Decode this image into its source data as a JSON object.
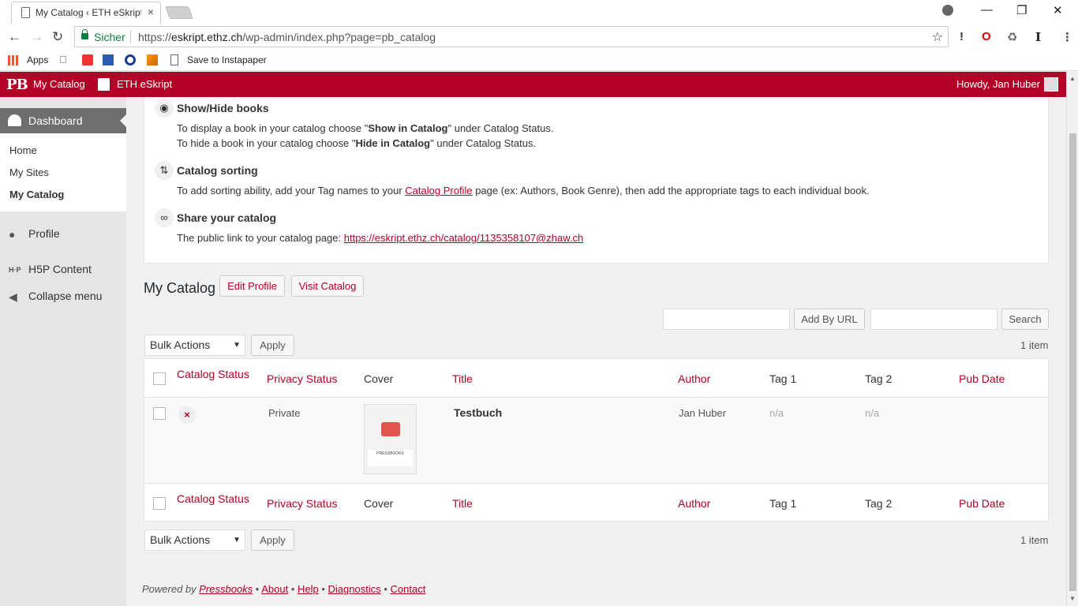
{
  "browser": {
    "tab_title": "My Catalog ‹ ETH eSkript",
    "tab_close": "×",
    "url_secure_label": "Sicher",
    "url_prefix": "https://",
    "url_host": "eskript.ethz.ch",
    "url_path": "/wp-admin/index.php?page=pb_catalog",
    "bookmarks": {
      "apps": "Apps",
      "instapaper": "Save to Instapaper"
    }
  },
  "adminbar": {
    "logo": "PB",
    "my_catalog": "My Catalog",
    "site_name": "ETH eSkript",
    "howdy": "Howdy, Jan Huber"
  },
  "sidebar": {
    "dashboard": "Dashboard",
    "submenu": [
      "Home",
      "My Sites",
      "My Catalog"
    ],
    "profile": "Profile",
    "h5p": "H5P Content",
    "collapse": "Collapse menu"
  },
  "info": {
    "show_hide": {
      "title": "Show/Hide books",
      "line1_pre": "To display a book in your catalog choose \"",
      "line1_bold": "Show in Catalog",
      "line1_post": "\" under Catalog Status.",
      "line2_pre": "To hide a book in your catalog choose \"",
      "line2_bold": "Hide in Catalog",
      "line2_post": "\" under Catalog Status."
    },
    "sorting": {
      "title": "Catalog sorting",
      "pre": "To add sorting ability, add your Tag names to your ",
      "link": "Catalog Profile",
      "post": " page (ex: Authors, Book Genre), then add the appropriate tags to each individual book."
    },
    "share": {
      "title": "Share your catalog",
      "pre": "The public link to your catalog page: ",
      "link": "https://eskript.ethz.ch/catalog/1135358107@zhaw.ch"
    }
  },
  "catalog": {
    "heading": "My Catalog",
    "edit_profile": "Edit Profile",
    "visit_catalog": "Visit Catalog",
    "add_by_url": "Add By URL",
    "search": "Search",
    "bulk_actions": "Bulk Actions",
    "apply": "Apply",
    "item_count": "1 item"
  },
  "table": {
    "columns": [
      "Catalog Status",
      "Privacy Status",
      "Cover",
      "Title",
      "Author",
      "Tag 1",
      "Tag 2",
      "Pub Date"
    ],
    "rows": [
      {
        "status": "×",
        "privacy": "Private",
        "cover_label": "PRESSBOOKS",
        "title": "Testbuch",
        "author": "Jan Huber",
        "tag1": "n/a",
        "tag2": "n/a",
        "pub_date": ""
      }
    ]
  },
  "footer": {
    "powered_by": "Powered by ",
    "pressbooks": "Pressbooks",
    "bullet": " • ",
    "about": "About",
    "help": "Help",
    "diagnostics": "Diagnostics",
    "contact": "Contact"
  },
  "colors": {
    "accent": "#b40026",
    "admin_bar": "#b40026"
  }
}
